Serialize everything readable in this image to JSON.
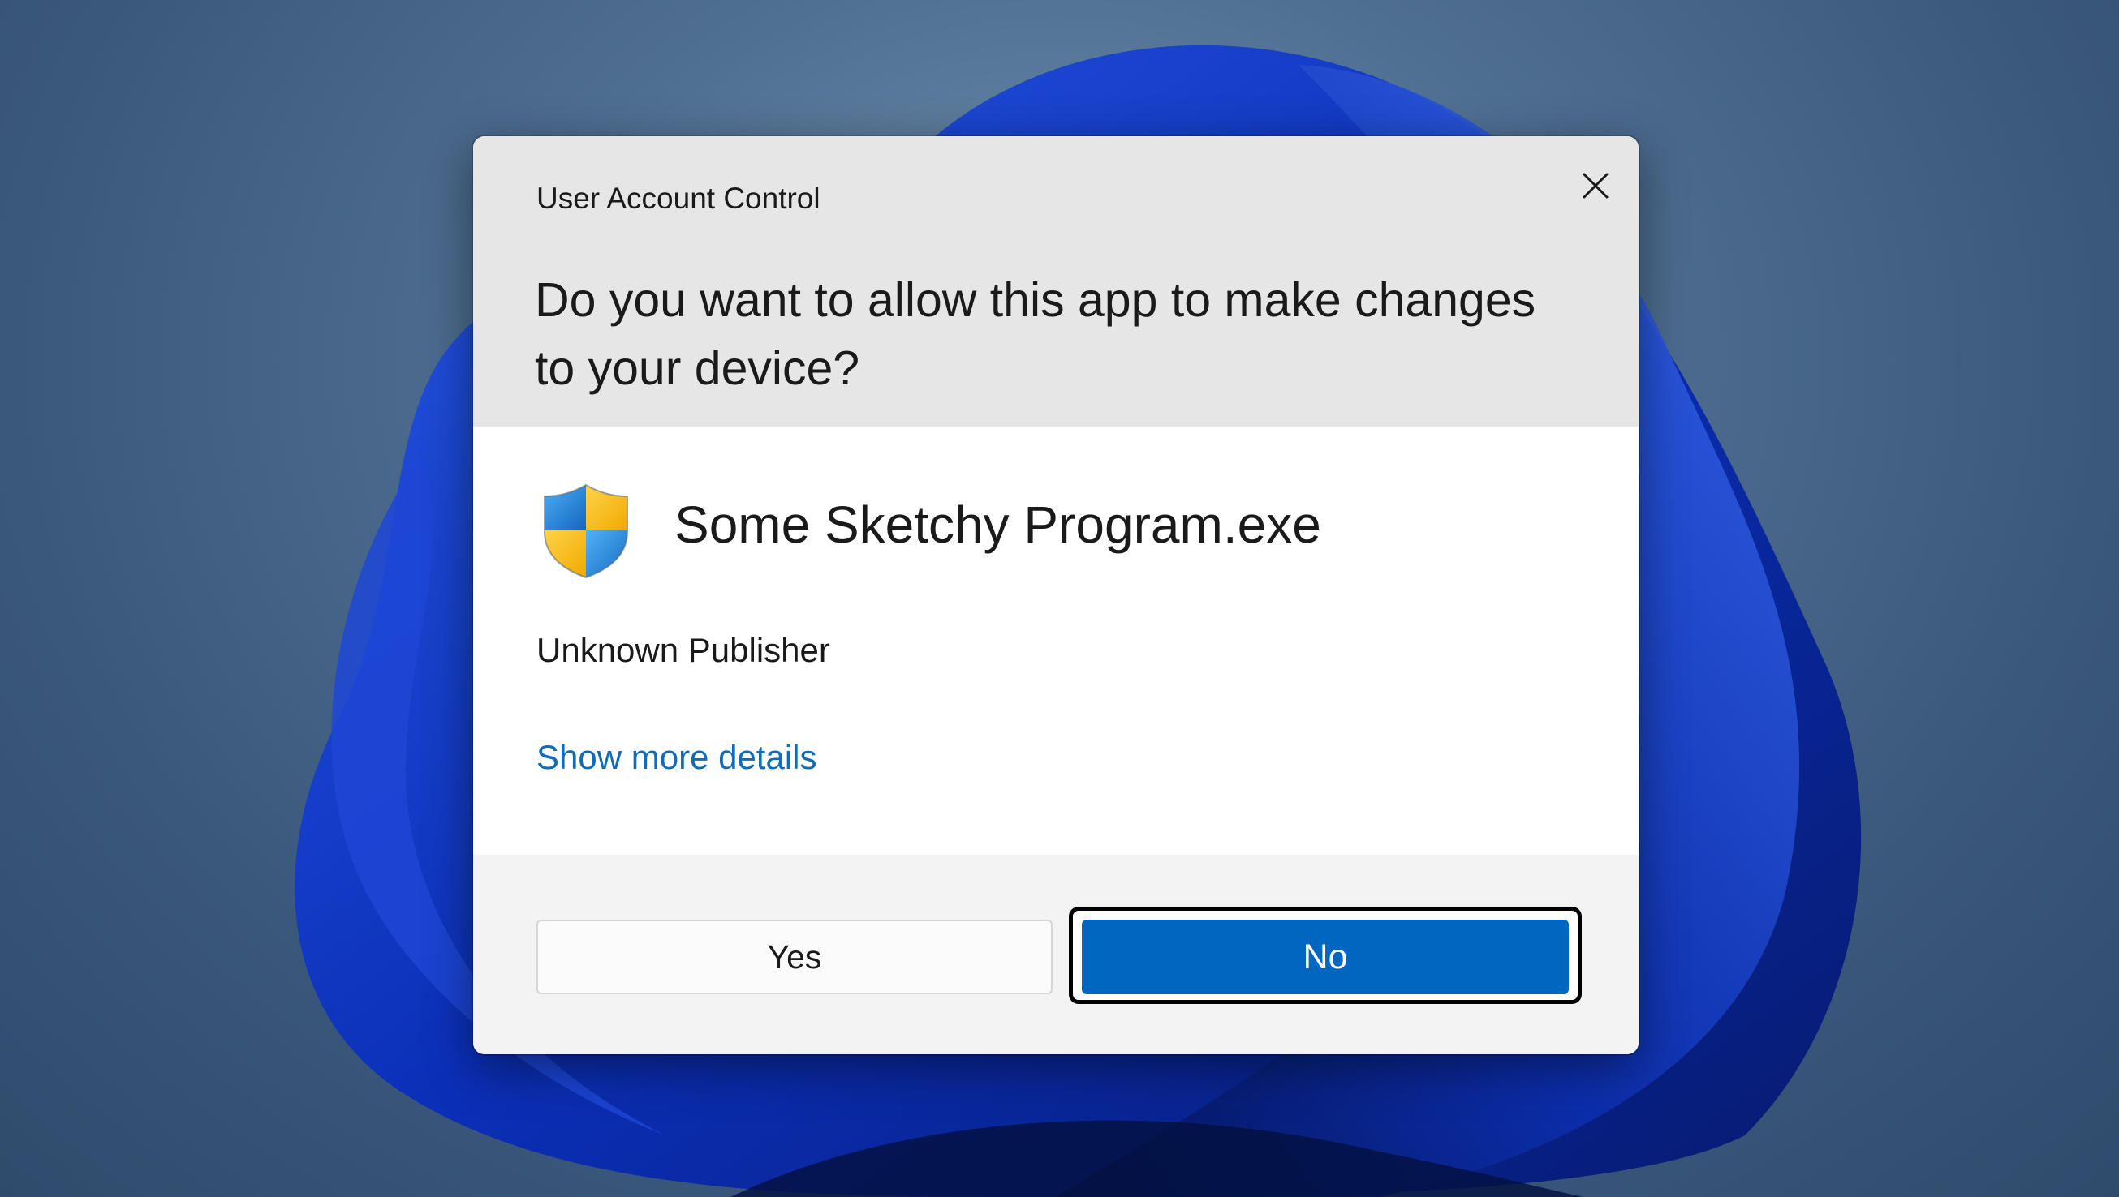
{
  "dialog": {
    "title": "User Account Control",
    "question": "Do you want to allow this app to make changes to your device?",
    "close_icon": "close-icon",
    "app_icon": "uac-shield-icon",
    "app_name": "Some Sketchy Program.exe",
    "publisher": "Unknown Publisher",
    "details_link": "Show more details",
    "buttons": {
      "yes_label": "Yes",
      "no_label": "No",
      "focused": "No"
    }
  },
  "colors": {
    "accent": "#0067c0",
    "link": "#0f6cbd",
    "header_bg": "#e6e6e6",
    "body_bg": "#ffffff",
    "footer_bg": "#f3f3f3",
    "shield_blue": "#1e88e5",
    "shield_yellow": "#f6c000"
  }
}
